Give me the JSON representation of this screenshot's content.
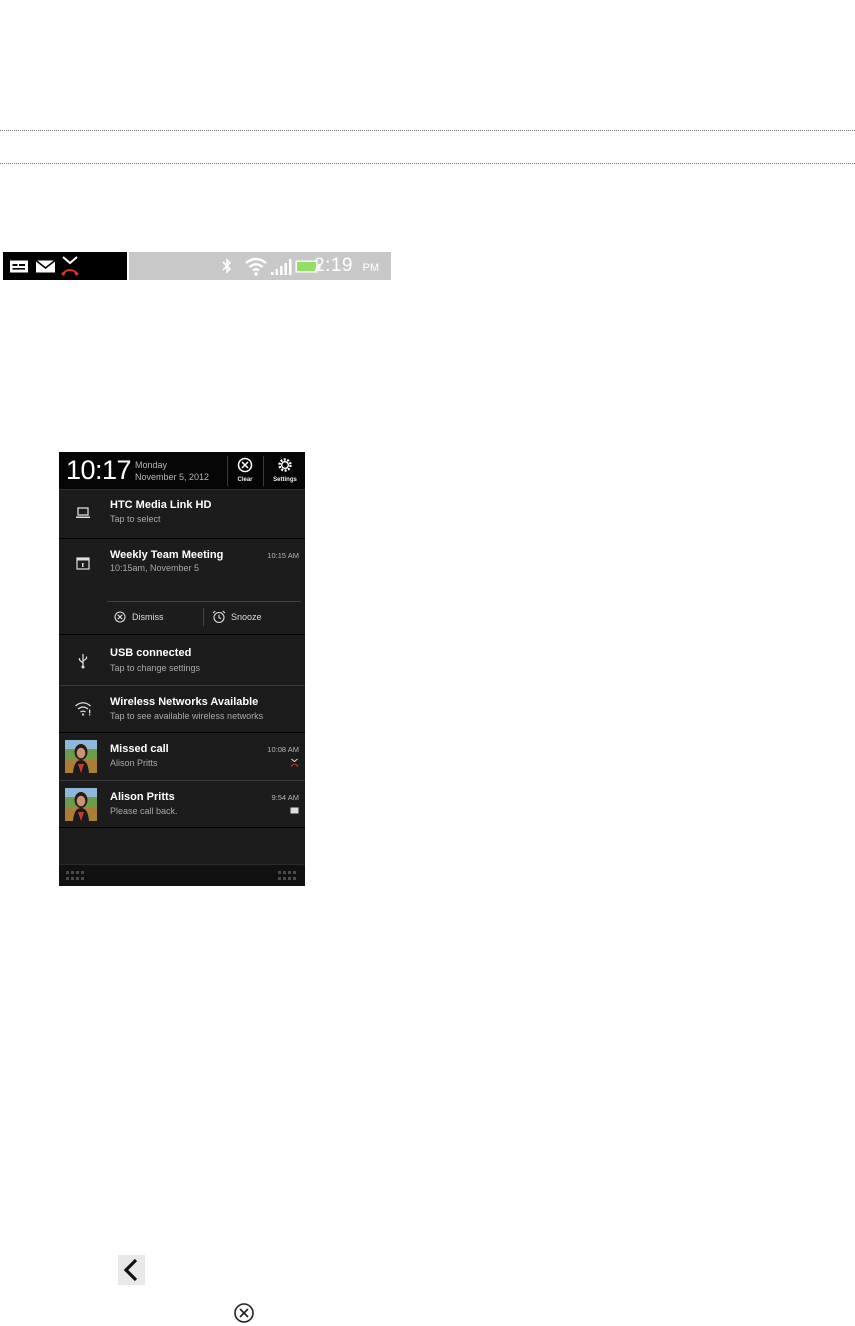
{
  "status_bar": {
    "time": "2:19",
    "ampm": "PM",
    "left_icons": [
      "message-icon",
      "mail-icon",
      "missed-call-icon"
    ],
    "right_icons": [
      "bluetooth-icon",
      "wifi-icon",
      "signal-icon",
      "battery-icon"
    ]
  },
  "notification_panel": {
    "clock": "10:17",
    "day": "Monday",
    "date": "November 5, 2012",
    "clear_label": "Clear",
    "settings_label": "Settings",
    "items": [
      {
        "icon": "laptop-icon",
        "title": "HTC Media Link HD",
        "subtitle": "Tap to select"
      },
      {
        "icon": "calendar-icon",
        "title": "Weekly Team Meeting",
        "subtitle": "10:15am, November 5",
        "time": "10:15 AM",
        "actions": {
          "dismiss": "Dismiss",
          "snooze": "Snooze"
        }
      },
      {
        "icon": "usb-icon",
        "title": "USB connected",
        "subtitle": "Tap to change settings"
      },
      {
        "icon": "wifi-icon",
        "title": "Wireless Networks Available",
        "subtitle": "Tap to see available wireless networks"
      },
      {
        "icon": "avatar",
        "title": "Missed call",
        "subtitle": "Alison Pritts",
        "time": "10:08 AM",
        "status_icon": "missed-call-icon"
      },
      {
        "icon": "avatar",
        "title": "Alison Pritts",
        "subtitle": "Please call back.",
        "time": "9:54 AM",
        "status_icon": "message-icon"
      }
    ]
  },
  "colors": {
    "panel_bg": "#1c1c1c",
    "missed_call_red": "#e0302a",
    "battery_green": "#8fe060"
  },
  "page_icons": [
    "back-chevron-icon",
    "close-circle-icon"
  ]
}
